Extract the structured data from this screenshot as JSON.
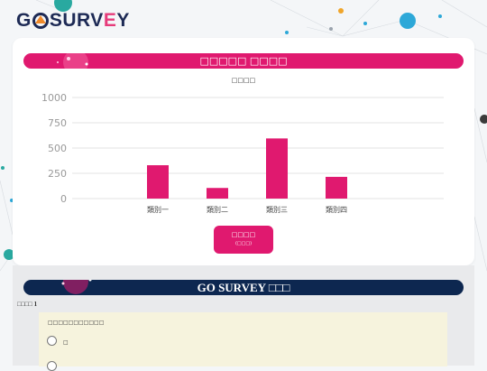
{
  "header": {
    "logo_text_a": "G",
    "logo_text_b": "SURV",
    "logo_text_e": "E",
    "logo_text_c": "Y",
    "logo_icon": "survey-logo-mark"
  },
  "results_section": {
    "banner_title": "□□□□□ □□□□",
    "chart_title": "□□□□",
    "results_button": {
      "line1": "□□□□",
      "line2": "(□□□)"
    }
  },
  "chart_data": {
    "type": "bar",
    "title": "□□□□",
    "categories": [
      "類別一",
      "類別二",
      "類別三",
      "類別四"
    ],
    "values": [
      330,
      105,
      595,
      215
    ],
    "ylim": [
      0,
      1000
    ],
    "yticks": [
      0,
      250,
      500,
      750,
      1000
    ],
    "grid": true,
    "bar_color": "#e0196f"
  },
  "survey_section": {
    "banner_title": "GO SURVEY □□□",
    "question_label": "□□□□ 1",
    "question_text": "□□□□□□□□□□□",
    "options": [
      {
        "label": "□"
      },
      {
        "label": ""
      }
    ]
  },
  "colors": {
    "accent_pink": "#e0196f",
    "navy": "#0d2750",
    "question_bg": "#f6f3dd"
  }
}
